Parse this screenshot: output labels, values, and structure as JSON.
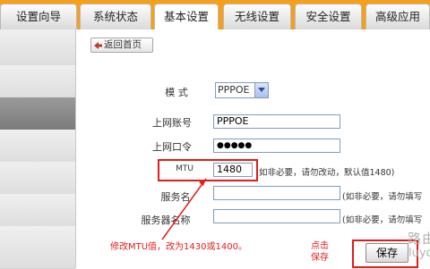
{
  "tabs": [
    {
      "label": "设置向导",
      "active": false
    },
    {
      "label": "系统状态",
      "active": false
    },
    {
      "label": "基本设置",
      "active": true
    },
    {
      "label": "无线设置",
      "active": false
    },
    {
      "label": "安全设置",
      "active": false
    },
    {
      "label": "高级应用",
      "active": false
    }
  ],
  "back_button": {
    "label": "返回首页"
  },
  "form": {
    "mode": {
      "label": "模  式",
      "value": "PPPOE"
    },
    "account": {
      "label": "上网账号",
      "value": "PPPOE"
    },
    "password": {
      "label": "上网口令",
      "value": "●●●●●"
    },
    "mtu": {
      "label": "MTU",
      "value": "1480",
      "hint": "如非必要，请勿改动，默认值1480)"
    },
    "service_name": {
      "label": "服务名",
      "value": "",
      "hint": "(如非必要，请勿填写"
    },
    "server_name": {
      "label": "服务器名称",
      "value": "",
      "hint": "(如非必要，请勿填写"
    }
  },
  "annotations": {
    "mtu_note": "修改MTU值，改为1430或1400。",
    "save_note_line1": "点击",
    "save_note_line2": "保存"
  },
  "save_button": {
    "label": "保存"
  },
  "watermark": {
    "line1": "路由",
    "line2": "luyo"
  },
  "colors": {
    "tab_bar": "#f6a01a",
    "annotation_red": "#e31b1b",
    "sidebar_active": "#8a8a8a"
  }
}
